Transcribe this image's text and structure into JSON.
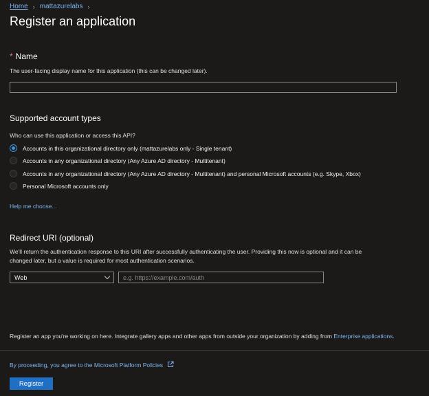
{
  "breadcrumb": {
    "home": "Home",
    "tenant": "mattazurelabs"
  },
  "page_title": "Register an application",
  "name_section": {
    "required_marker": "*",
    "title": "Name",
    "description": "The user-facing display name for this application (this can be changed later).",
    "value": ""
  },
  "account_types": {
    "title": "Supported account types",
    "question": "Who can use this application or access this API?",
    "options": [
      {
        "label": "Accounts in this organizational directory only (mattazurelabs only - Single tenant)",
        "selected": true
      },
      {
        "label": "Accounts in any organizational directory (Any Azure AD directory - Multitenant)",
        "selected": false
      },
      {
        "label": "Accounts in any organizational directory (Any Azure AD directory - Multitenant) and personal Microsoft accounts (e.g. Skype, Xbox)",
        "selected": false
      },
      {
        "label": "Personal Microsoft accounts only",
        "selected": false
      }
    ],
    "help_link": "Help me choose..."
  },
  "redirect": {
    "title": "Redirect URI (optional)",
    "description_line1": "We'll return the authentication response to this URI after successfully authenticating the user. Providing this now is optional and it can be",
    "description_line2": "changed later, but a value is required for most authentication scenarios.",
    "platform": "Web",
    "uri_placeholder": "e.g. https://example.com/auth",
    "uri_value": ""
  },
  "footer": {
    "info_text": "Register an app you're working on here. Integrate gallery apps and other apps from outside your organization by adding from",
    "enterprise_link": "Enterprise applications",
    "period": ".",
    "policy_link": "By proceeding, you agree to the Microsoft Platform Policies",
    "policy_icon": "external-link-icon",
    "register_label": "Register"
  },
  "colors": {
    "accent": "#3a96dd",
    "link": "#7fb6f0",
    "button": "#1f6fc4",
    "background": "#1b1a19"
  }
}
